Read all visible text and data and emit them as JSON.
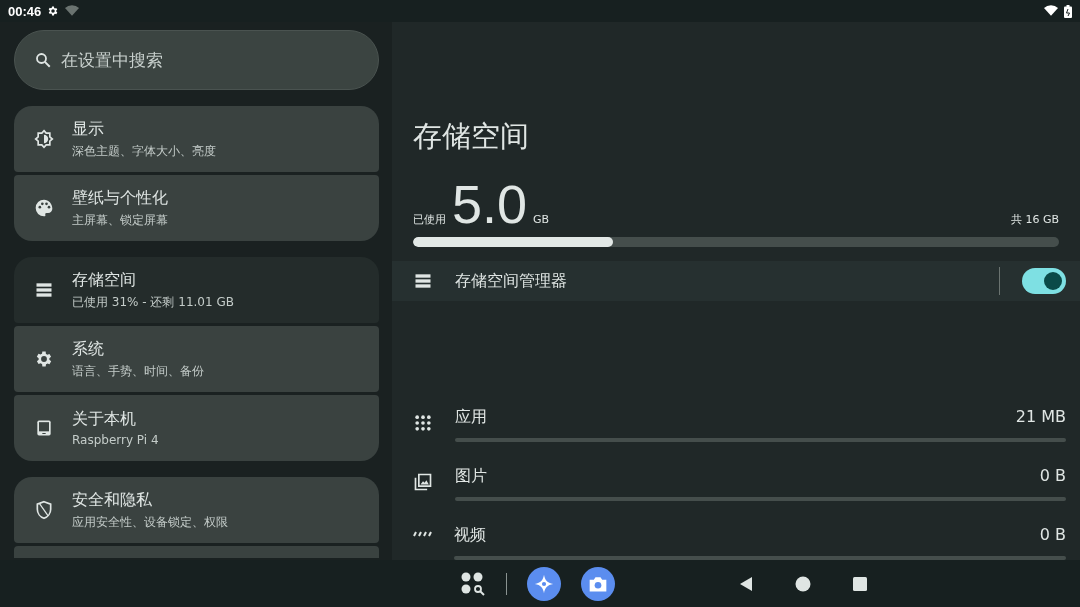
{
  "status_bar": {
    "time": "00:46"
  },
  "search": {
    "placeholder": "在设置中搜索"
  },
  "sidebar": {
    "groups": [
      {
        "items": [
          {
            "kind": "brightness",
            "title": "显示",
            "subtitle": "深色主题、字体大小、亮度",
            "selected": false
          },
          {
            "kind": "palette",
            "title": "壁纸与个性化",
            "subtitle": "主屏幕、锁定屏幕",
            "selected": false
          }
        ]
      },
      {
        "items": [
          {
            "kind": "storage",
            "title": "存储空间",
            "subtitle": "已使用 31% - 还剩 11.01 GB",
            "selected": true
          },
          {
            "kind": "gear",
            "title": "系统",
            "subtitle": "语言、手势、时间、备份",
            "selected": false
          },
          {
            "kind": "device",
            "title": "关于本机",
            "subtitle": "Raspberry Pi 4",
            "selected": false
          }
        ]
      },
      {
        "items": [
          {
            "kind": "shield",
            "title": "安全和隐私",
            "subtitle": "应用安全性、设备锁定、权限",
            "selected": false
          }
        ],
        "more_below": true
      }
    ]
  },
  "page": {
    "title": "存储空间",
    "usage": {
      "used_label": "已使用",
      "amount": "5.0",
      "unit": "GB",
      "total": "共 16 GB",
      "level": 0.31
    },
    "manager": {
      "label": "存储空间管理器",
      "on": true
    },
    "categories": [
      {
        "kind": "apps",
        "label": "应用",
        "size": "21 MB"
      },
      {
        "kind": "image",
        "label": "图片",
        "size": "0 B"
      },
      {
        "kind": "video",
        "label": "视频",
        "size": "0 B"
      }
    ]
  }
}
